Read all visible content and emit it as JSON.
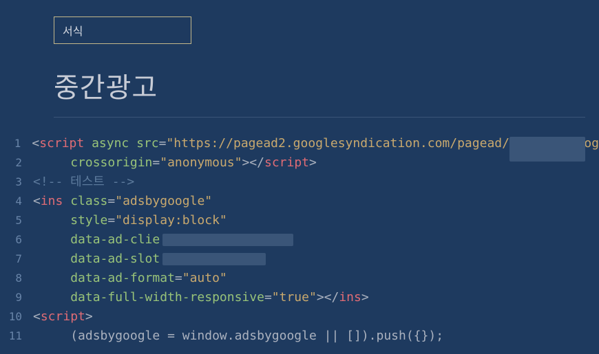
{
  "header": {
    "label": "서식"
  },
  "title": "중간광고",
  "code": {
    "lines": [
      {
        "num": "1"
      },
      {
        "num": "2"
      },
      {
        "num": "3"
      },
      {
        "num": "4"
      },
      {
        "num": "5"
      },
      {
        "num": "6"
      },
      {
        "num": "7"
      },
      {
        "num": "8"
      },
      {
        "num": "9"
      },
      {
        "num": "10"
      },
      {
        "num": "11"
      }
    ],
    "tokens": {
      "script": "script",
      "async": "async",
      "src": "src",
      "srcVal": "\"https://pagead2.googlesyndication.com/pagead/js/adsbygoog",
      "crossorigin": "crossorigin",
      "anonymous": "\"anonymous\"",
      "comment": "<!-- 테스트 -->",
      "ins": "ins",
      "class": "class",
      "adsbygoogle": "\"adsbygoogle\"",
      "style": "style",
      "displayBlock": "\"display:block\"",
      "dataAdClie": "data-ad-clie",
      "dataAdSlot": "data-ad-slot",
      "dataAdFormat": "data-ad-format",
      "auto": "\"auto\"",
      "dataFullWidth": "data-full-width-responsive",
      "true": "\"true\"",
      "pushLine": "(adsbygoogle = window.adsbygoogle || []).push({});"
    }
  }
}
